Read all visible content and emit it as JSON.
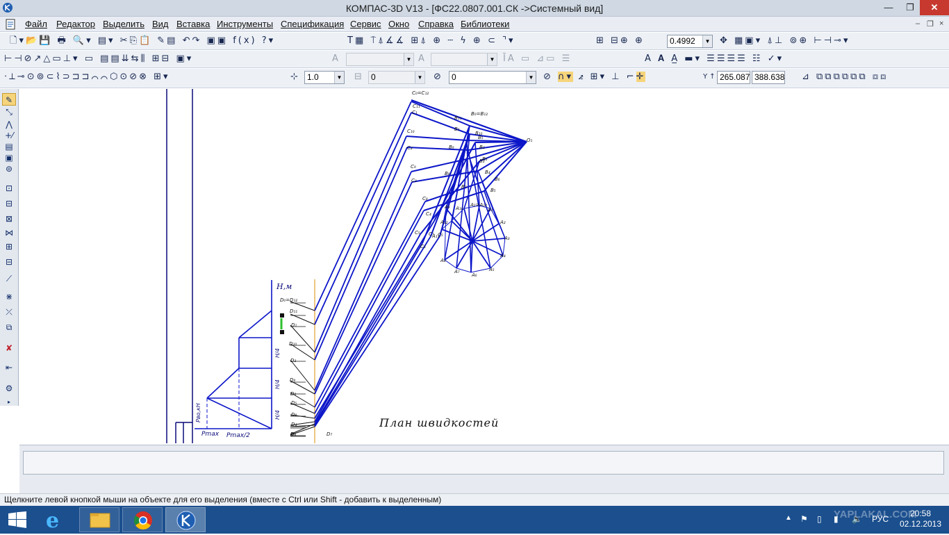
{
  "window": {
    "title": "КОМПАС-3D V13 - [ФС22.0807.001.СК ->Системный вид]",
    "minimize": "—",
    "maximize": "❐",
    "close": "✕"
  },
  "menu": {
    "items": [
      "Файл",
      "Редактор",
      "Выделить",
      "Вид",
      "Вставка",
      "Инструменты",
      "Спецификация",
      "Сервис",
      "Окно",
      "Справка",
      "Библиотеки"
    ],
    "mdi_buttons": [
      "–",
      "❐",
      "×"
    ]
  },
  "toolbar1": {
    "zoom_value": "0.4992"
  },
  "toolbar2": {
    "font_combo": "",
    "size_combo": ""
  },
  "toolbar3": {
    "step_value": "1.0",
    "layer_value": "0",
    "style_value": "0",
    "coord_x": "265.087",
    "coord_y": "388.638"
  },
  "drawing": {
    "caption": "План швидкостей",
    "axis_label": "H,м",
    "pmax": "Pmax",
    "pmax_half": "Pmax/2",
    "pvo": "Pво,кН",
    "h_quarter": "H/4",
    "d_labels": [
      "D₀=D₁₂",
      "D₁₁",
      "D₁",
      "D₁₀",
      "D₂",
      "D₉",
      "D₃",
      "D₅",
      "D₈",
      "D₄",
      "D₆",
      "D₇",
      "D₅"
    ],
    "c_labels": [
      "C₀=C₁₂",
      "C₁₁",
      "C₁",
      "C₁₀",
      "C₂",
      "C₉",
      "C₃",
      "C₈",
      "C₄",
      "C₅",
      "C₆",
      "C₇",
      "C₅"
    ],
    "b_labels": [
      "B₀=B₁₂",
      "B₁₁",
      "B₁₀",
      "B₉",
      "B₈",
      "B₁",
      "B₂",
      "B₃",
      "B₄",
      "B₅",
      "B₆",
      "B₇",
      "B₅",
      "B₆"
    ],
    "a_labels": [
      "A₁₂",
      "A₀=A₁₂",
      "A₁",
      "A₂",
      "A₃",
      "A₄",
      "A₅",
      "A₆",
      "A₇",
      "A₈",
      "A₉",
      "A₁₀",
      "A₁₁"
    ],
    "pole": "O₁",
    "colors": {
      "blue": "#0c16c8",
      "dark": "#0a0a7a",
      "orange": "#e0a030",
      "magenta": "#e040c0"
    }
  },
  "statusbar": {
    "hint": "Щелкните левой кнопкой мыши на объекте для его выделения (вместе с Ctrl или Shift - добавить к выделенным)"
  },
  "taskbar": {
    "apps": [
      "start-icon",
      "ie-icon",
      "explorer-icon",
      "chrome-icon",
      "kompas-icon"
    ],
    "language": "РУС",
    "time": "20:58",
    "date": "02.12.2013",
    "watermark": "YAPLAKAL.COM"
  }
}
